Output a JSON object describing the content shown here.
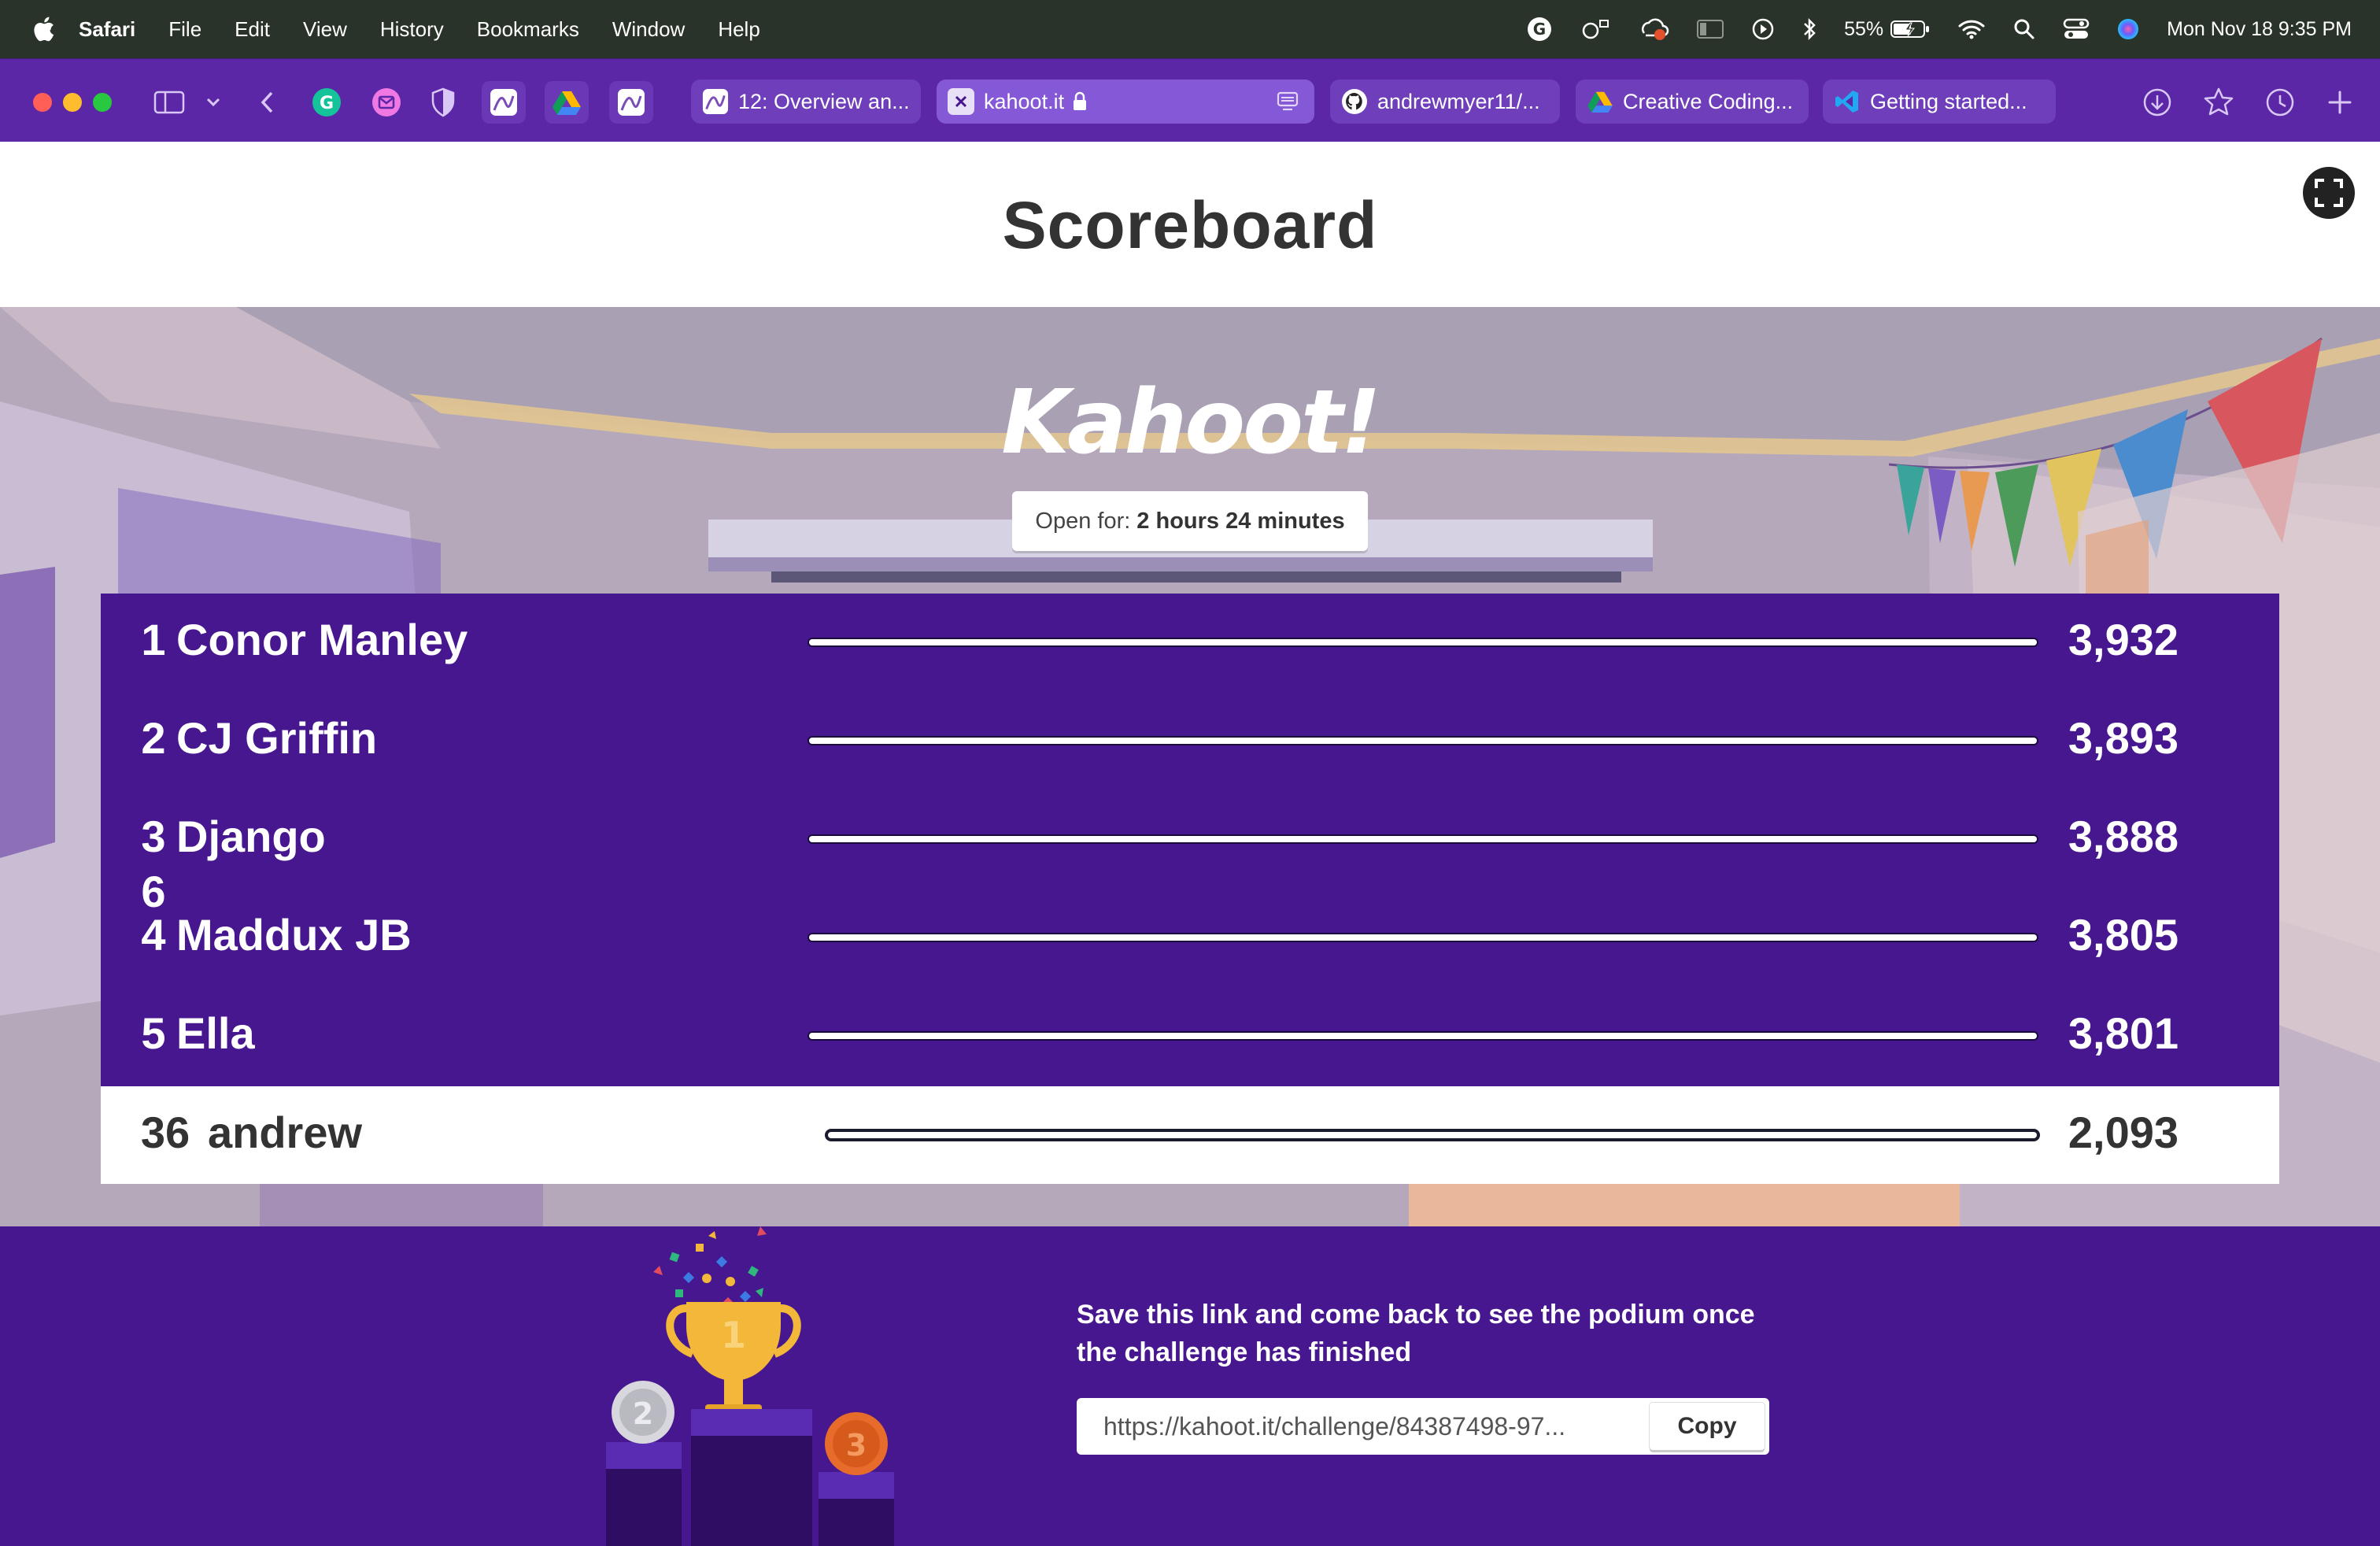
{
  "menubar": {
    "app_name": "Safari",
    "items": [
      "File",
      "Edit",
      "View",
      "History",
      "Bookmarks",
      "Window",
      "Help"
    ],
    "battery": "55%",
    "datetime": "Mon Nov 18  9:35 PM"
  },
  "browser": {
    "tabs": [
      {
        "label": "12: Overview an...",
        "icon": "chart-favicon"
      },
      {
        "label": "kahoot.it",
        "icon": "kahoot-favicon",
        "active": true
      },
      {
        "label": "andrewmyer11/...",
        "icon": "github-favicon"
      },
      {
        "label": "Creative Coding...",
        "icon": "drive-favicon"
      },
      {
        "label": "Getting started...",
        "icon": "vscode-favicon"
      }
    ]
  },
  "page": {
    "title": "Scoreboard"
  },
  "kahoot": {
    "logo": "Kahoot!",
    "open_for_label": "Open for:",
    "open_for_value": "2 hours 24 minutes"
  },
  "leaderboard": [
    {
      "rank": "1",
      "name": "Conor Manley",
      "score": "3,932"
    },
    {
      "rank": "2",
      "name": "CJ Griffin",
      "score": "3,893"
    },
    {
      "rank": "3",
      "name": "Django",
      "score": "3,888"
    },
    {
      "rank": "4",
      "name": "Maddux JB",
      "score": "3,805"
    },
    {
      "rank": "5",
      "name": "Ella",
      "score": "3,801"
    }
  ],
  "stray_rank": "6",
  "current_player": {
    "rank": "36",
    "name": "andrew",
    "score": "2,093"
  },
  "footer": {
    "message": "Save this link and come back to see the podium once the challenge has finished",
    "link": "https://kahoot.it/challenge/84387498-97...",
    "copy_label": "Copy",
    "podium_labels": [
      "1",
      "2",
      "3"
    ]
  },
  "colors": {
    "kahoot_purple": "#46178f",
    "toolbar_purple": "#5b27a6",
    "menubar": "#2a3329"
  }
}
